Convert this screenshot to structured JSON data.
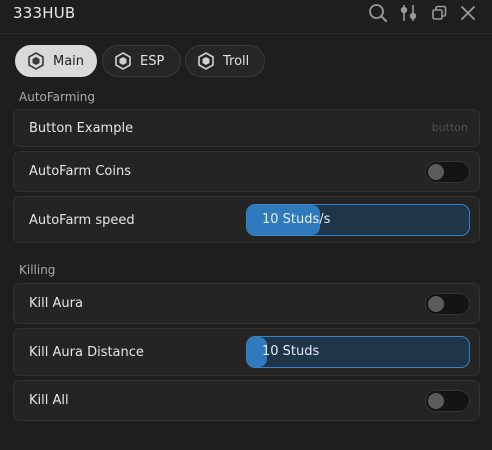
{
  "window": {
    "title": "333HUB"
  },
  "titlebar_icons": [
    "search-icon",
    "settings-sliders-icon",
    "restore-icon",
    "close-icon"
  ],
  "tabs": [
    {
      "label": "Main",
      "active": true,
      "icon": "tab-logo-icon"
    },
    {
      "label": "ESP",
      "active": false,
      "icon": "tab-logo-icon"
    },
    {
      "label": "Troll",
      "active": false,
      "icon": "tab-logo-icon"
    }
  ],
  "sections": {
    "autofarming": {
      "title": "AutoFarming",
      "button_example": {
        "label": "Button Example",
        "hint": "button"
      },
      "autofarm_coins": {
        "label": "AutoFarm Coins",
        "enabled": false
      },
      "autofarm_speed": {
        "label": "AutoFarm speed",
        "value_text": "10 Studs/s",
        "fill_percent": 33
      }
    },
    "killing": {
      "title": "Killing",
      "kill_aura": {
        "label": "Kill Aura",
        "enabled": false
      },
      "kill_aura_distance": {
        "label": "Kill Aura Distance",
        "value_text": "10 Studs",
        "fill_percent": 9
      },
      "kill_all": {
        "label": "Kill All",
        "enabled": false
      }
    }
  },
  "colors": {
    "background": "#1e1e1e",
    "row": "#242424",
    "accent": "#2f79bd",
    "active_tab": "#d9d9d9"
  }
}
